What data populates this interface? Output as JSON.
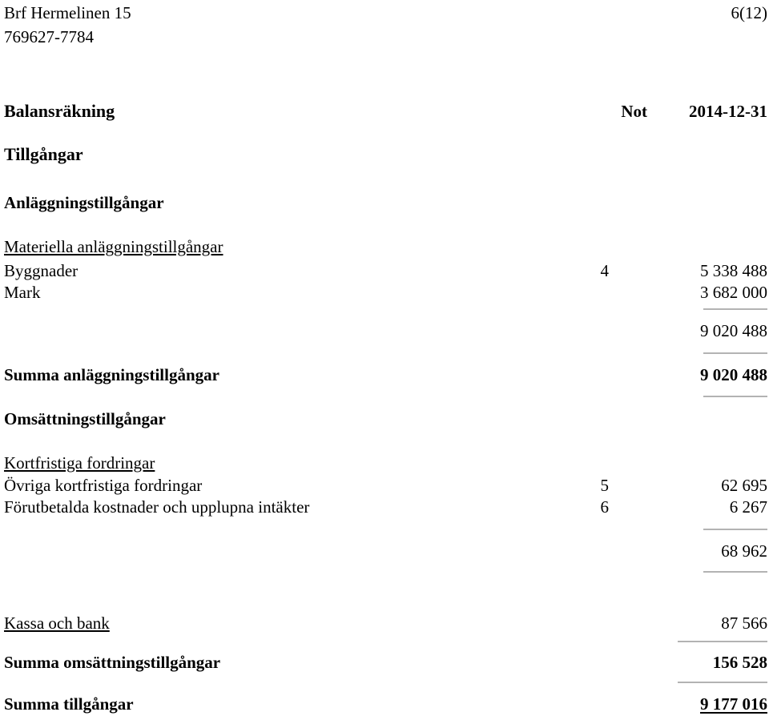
{
  "document": {
    "company_name": "Brf Hermelinen 15",
    "org_number": "769627-7784",
    "page_indicator": "6(12)",
    "title": "Balansräkning",
    "column_headers": {
      "note": "Not",
      "period": "2014-12-31"
    },
    "accent_rule_color": "#b3b3b3"
  },
  "sections": {
    "assets_heading": "Tillgångar",
    "fixed_assets_heading": "Anläggningstillgångar",
    "tangible_assets_heading": "Materiella anläggningstillgångar",
    "current_assets_heading": "Omsättningstillgångar",
    "short_term_receivables_heading": "Kortfristiga fordringar"
  },
  "lines": {
    "byggnader": {
      "label": "Byggnader",
      "note": "4",
      "amount": "5 338 488"
    },
    "mark": {
      "label": "Mark",
      "note": "",
      "amount": "3 682 000"
    },
    "tangible_subtotal": {
      "label": "",
      "note": "",
      "amount": "9 020 488"
    },
    "summa_anlaggningstillgangar": {
      "label": "Summa anläggningstillgångar",
      "note": "",
      "amount": "9 020 488"
    },
    "ovriga_kortfristiga_fordringar": {
      "label": "Övriga kortfristiga fordringar",
      "note": "5",
      "amount": "62 695"
    },
    "forutbetalda_kostnader": {
      "label": "Förutbetalda kostnader och upplupna intäkter",
      "note": "6",
      "amount": "6 267"
    },
    "receivables_subtotal": {
      "label": "",
      "note": "",
      "amount": "68 962"
    },
    "kassa_och_bank": {
      "label": "Kassa och bank",
      "note": "",
      "amount": "87 566"
    },
    "summa_omsattningstillgangar": {
      "label": "Summa omsättningstillgångar",
      "note": "",
      "amount": "156 528"
    },
    "summa_tillgangar": {
      "label": "Summa tillgångar",
      "note": "",
      "amount": "9 177 016"
    }
  }
}
